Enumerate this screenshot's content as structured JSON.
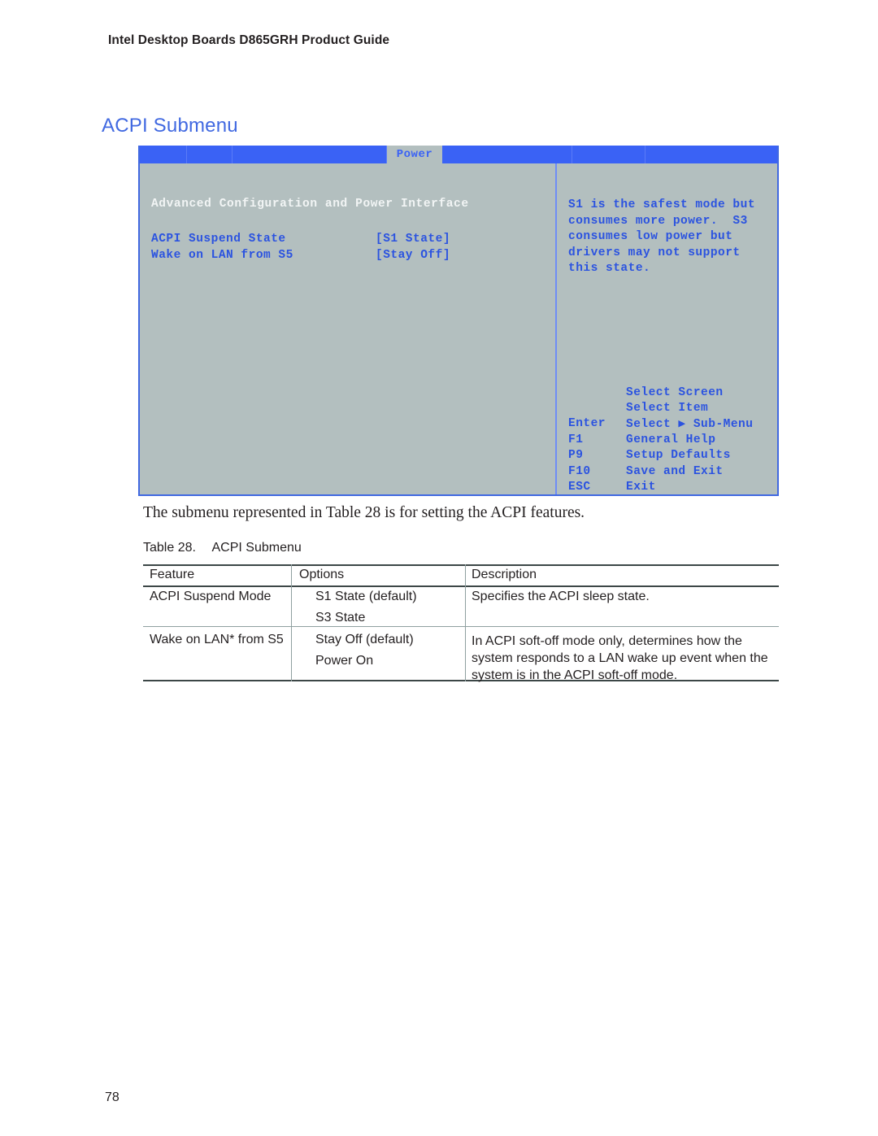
{
  "document": {
    "running_header": "Intel Desktop Boards D865GRH Product Guide",
    "page_number": "78",
    "section_heading": "ACPI Submenu",
    "body_paragraph": "The submenu represented in Table 28 is for setting the ACPI features.",
    "colors": {
      "heading_blue": "#4169e1",
      "bios_menubar_blue": "#3a62f5",
      "bios_background_gray": "#b3bfbf",
      "bios_text_blue": "#2b53e0",
      "bios_title_white": "#f2f5f5",
      "rule_dark": "#3c4747",
      "rule_light": "#8fa0a0"
    }
  },
  "bios_screen": {
    "menu_tabs": [
      {
        "label": "",
        "active": false
      },
      {
        "label": "",
        "active": false
      },
      {
        "label": "",
        "active": false
      },
      {
        "label": "Power",
        "active": true
      },
      {
        "label": "",
        "active": false
      },
      {
        "label": "",
        "active": false
      },
      {
        "label": "",
        "active": false
      },
      {
        "label": "",
        "active": false
      }
    ],
    "active_tab_label": "Power",
    "panel_title": "Advanced Configuration and Power Interface",
    "settings": [
      {
        "label": "ACPI Suspend State",
        "value": "[S1 State]"
      },
      {
        "label": "Wake on LAN from S5",
        "value": "[Stay Off]"
      }
    ],
    "help_lines": [
      "S1 is the safest mode but",
      "consumes more power.  S3",
      "consumes low power but",
      "drivers may not support",
      "this state."
    ],
    "legend": [
      {
        "key": "",
        "action": "Select Screen",
        "arrow": ""
      },
      {
        "key": "",
        "action": "Select Item",
        "arrow": ""
      },
      {
        "key": "Enter",
        "action_before": "Select ",
        "arrow": "▶",
        "action_after": " Sub-Menu",
        "action": "Select ▶ Sub-Menu"
      },
      {
        "key": "F1",
        "action": "General Help",
        "arrow": ""
      },
      {
        "key": "P9",
        "action": "Setup Defaults",
        "arrow": ""
      },
      {
        "key": "F10",
        "action": "Save and Exit",
        "arrow": ""
      },
      {
        "key": "ESC",
        "action": "Exit",
        "arrow": ""
      }
    ]
  },
  "table": {
    "caption_number": "Table 28.",
    "caption_title": "ACPI Submenu",
    "headers": [
      "Feature",
      "Options",
      "Description"
    ],
    "rows": [
      {
        "feature": "ACPI Suspend Mode",
        "options": [
          "S1 State (default)",
          "S3 State"
        ],
        "description": "Specifies the ACPI sleep state."
      },
      {
        "feature": "Wake on LAN* from S5",
        "options": [
          "Stay Off (default)",
          "Power On"
        ],
        "description": "In ACPI soft-off mode only, determines how the system responds to a LAN wake up event when the system is in the ACPI soft-off mode."
      }
    ]
  }
}
